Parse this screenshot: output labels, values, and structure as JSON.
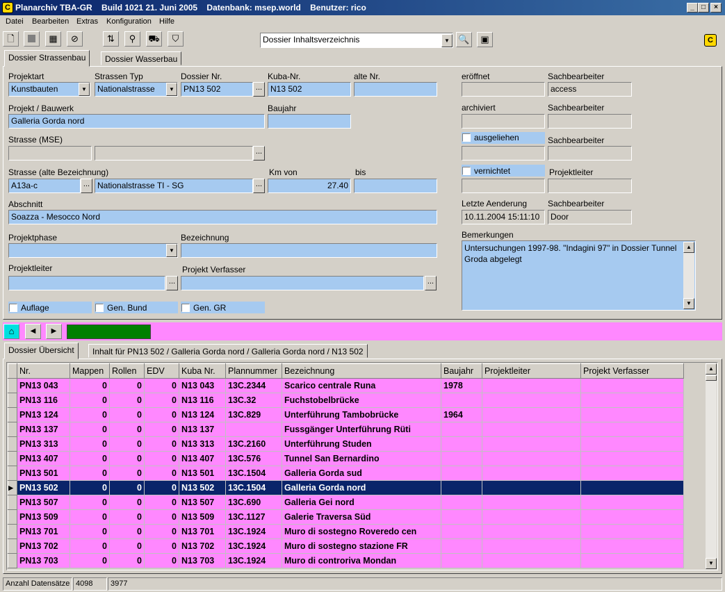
{
  "window": {
    "title": "Planarchiv TBA-GR    Build 1021 21. Juni 2005    Datenbank: msep.world    Benutzer: rico",
    "min": "_",
    "max": "□",
    "close": "×"
  },
  "menu": [
    "Datei",
    "Bearbeiten",
    "Extras",
    "Konfiguration",
    "Hilfe"
  ],
  "toolbar": {
    "report_select": "Dossier Inhaltsverzeichnis"
  },
  "tabs_top": [
    "Dossier Strassenbau",
    "Dossier Wasserbau"
  ],
  "form": {
    "projektart_label": "Projektart",
    "projektart": "Kunstbauten",
    "strassentyp_label": "Strassen Typ",
    "strassentyp": "Nationalstrasse",
    "dossiernr_label": "Dossier Nr.",
    "dossiernr": "PN13 502",
    "kubanr_label": "Kuba-Nr.",
    "kubanr": "N13 502",
    "altenr_label": "alte Nr.",
    "altenr": "",
    "projekt_label": "Projekt / Bauwerk",
    "projekt": "Galleria Gorda nord",
    "baujahr_label": "Baujahr",
    "baujahr": "",
    "strasse_mse_label": "Strasse (MSE)",
    "strasse_mse_1": "",
    "strasse_mse_2": "",
    "strasse_alt_label": "Strasse (alte Bezeichnung)",
    "strasse_alt_code": "A13a-c",
    "strasse_alt_name": "Nationalstrasse TI - SG",
    "kmvon_label": "Km von",
    "kmvon": "27.40",
    "bis_label": "bis",
    "bis": "",
    "abschnitt_label": "Abschnitt",
    "abschnitt": "Soazza - Mesocco Nord",
    "projektphase_label": "Projektphase",
    "projektphase": "",
    "bezeichnung_label": "Bezeichnung",
    "bezeichnung": "",
    "projektleiter_label": "Projektleiter",
    "projektleiter": "",
    "verfasser_label": "Projekt Verfasser",
    "verfasser": "",
    "auflage_label": "Auflage",
    "genbund_label": "Gen. Bund",
    "gengr_label": "Gen. GR"
  },
  "side": {
    "eroeffnet_label": "eröffnet",
    "eroeffnet": "",
    "sb1_label": "Sachbearbeiter",
    "sb1": "access",
    "archiviert_label": "archiviert",
    "archiviert": "",
    "sb2_label": "Sachbearbeiter",
    "sb2": "",
    "ausgeliehen_label": "ausgeliehen",
    "ausgeliehen": "",
    "sb3_label": "Sachbearbeiter",
    "sb3": "",
    "vernichtet_label": "vernichtet",
    "vernichtet": "",
    "pl_label": "Projektleiter",
    "pl": "",
    "letzte_label": "Letzte Aenderung",
    "letzte": "10.11.2004 15:11:10",
    "sb4_label": "Sachbearbeiter",
    "sb4": "Door",
    "bemerk_label": "Bemerkungen",
    "bemerk": "Untersuchungen 1997-98. \"Indagini 97\" in Dossier Tunnel Groda abgelegt"
  },
  "tabs_bottom": [
    "Dossier Übersicht",
    "Inhalt für PN13 502 / Galleria Gorda nord  / Galleria Gorda nord  / N13 502"
  ],
  "grid": {
    "headers": [
      "Nr.",
      "Mappen",
      "Rollen",
      "EDV",
      "Kuba Nr.",
      "Plannummer",
      "Bezeichnung",
      "Baujahr",
      "Projektleiter",
      "Projekt Verfasser"
    ],
    "rows": [
      [
        "PN13 043",
        "0",
        "0",
        "0",
        "N13 043",
        "13C.2344",
        "Scarico centrale Runa",
        "1978",
        "",
        ""
      ],
      [
        "PN13 116",
        "0",
        "0",
        "0",
        "N13 116",
        "13C.32",
        "Fuchstobelbrücke",
        "",
        "",
        ""
      ],
      [
        "PN13 124",
        "0",
        "0",
        "0",
        "N13 124",
        "13C.829",
        "Unterführung Tambobrücke",
        "1964",
        "",
        ""
      ],
      [
        "PN13 137",
        "0",
        "0",
        "0",
        "N13 137",
        "",
        "Fussgänger Unterführung  Rüti",
        "",
        "",
        ""
      ],
      [
        "PN13 313",
        "0",
        "0",
        "0",
        "N13 313",
        "13C.2160",
        "Unterführung Studen",
        "",
        "",
        ""
      ],
      [
        "PN13 407",
        "0",
        "0",
        "0",
        "N13 407",
        "13C.576",
        "Tunnel San Bernardino",
        "",
        "",
        ""
      ],
      [
        "PN13 501",
        "0",
        "0",
        "0",
        "N13 501",
        "13C.1504",
        "Galleria Gorda sud",
        "",
        "",
        ""
      ],
      [
        "PN13 502",
        "0",
        "0",
        "0",
        "N13 502",
        "13C.1504",
        "Galleria Gorda nord",
        "",
        "",
        ""
      ],
      [
        "PN13 507",
        "0",
        "0",
        "0",
        "N13 507",
        "13C.690",
        "Galleria Gei nord",
        "",
        "",
        ""
      ],
      [
        "PN13 509",
        "0",
        "0",
        "0",
        "N13 509",
        "13C.1127",
        "Galerie Traversa Süd",
        "",
        "",
        ""
      ],
      [
        "PN13 701",
        "0",
        "0",
        "0",
        "N13 701",
        "13C.1924",
        "Muro di sostegno  Roveredo cen",
        "",
        "",
        ""
      ],
      [
        "PN13 702",
        "0",
        "0",
        "0",
        "N13 702",
        "13C.1924",
        "Muro di sostegno  stazione FR",
        "",
        "",
        ""
      ],
      [
        "PN13 703",
        "0",
        "0",
        "0",
        "N13 703",
        "13C.1924",
        "Muro di controriva  Mondan",
        "",
        "",
        ""
      ]
    ],
    "selected_index": 7
  },
  "status": {
    "label": "Anzahl Datensätze",
    "total": "4098",
    "current": "3977"
  },
  "colors": {
    "field": "#a6caf0",
    "grid_row": "#ff88ff",
    "selected": "#0a246a",
    "nav_bar": "#ff88ff",
    "progress": "#008000"
  }
}
